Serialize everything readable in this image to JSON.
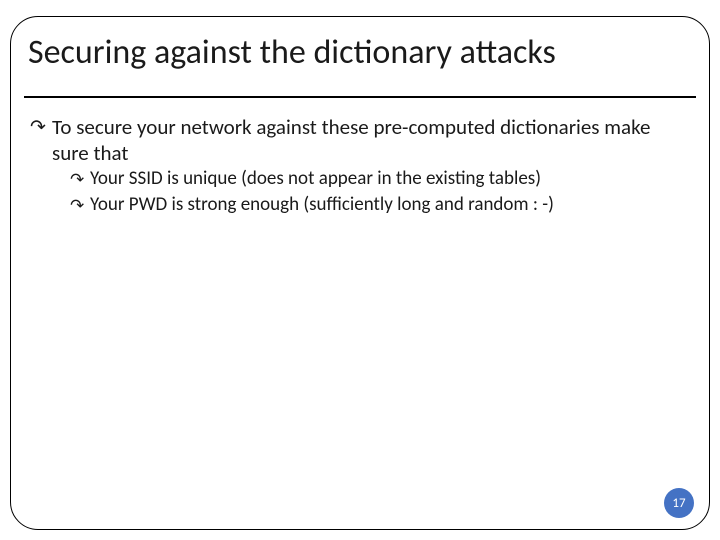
{
  "title": "Securing against the dictionary attacks",
  "bullet_glyph": "↷",
  "body": {
    "item1": {
      "text": "To secure your network against these pre-computed dictionaries make sure that",
      "sub": [
        "Your SSID is unique (does not appear in the existing tables)",
        "Your PWD is strong enough (sufficiently long and random : -)"
      ]
    }
  },
  "page_number": "17"
}
